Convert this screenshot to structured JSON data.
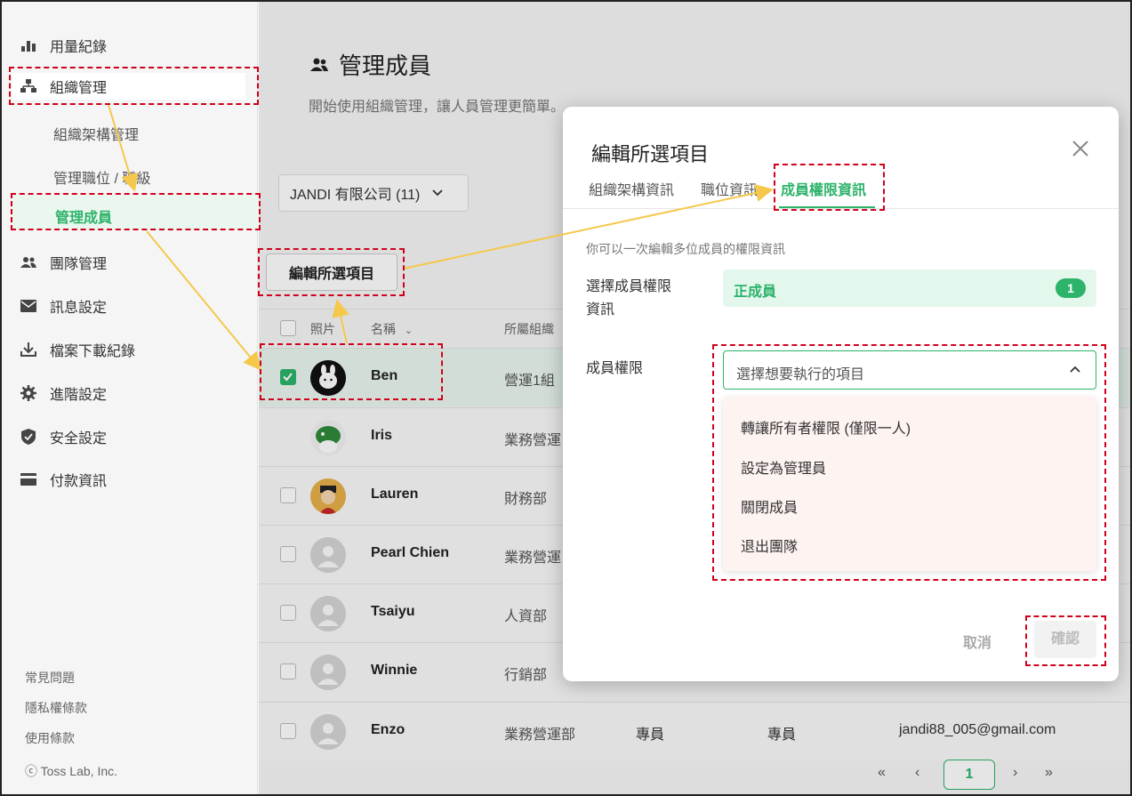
{
  "sidebar": {
    "items": [
      {
        "label": "用量紀錄",
        "icon": "bar-chart-icon"
      },
      {
        "label": "組織管理",
        "icon": "org-chart-icon"
      },
      {
        "label": "組織架構管理"
      },
      {
        "label": "管理職位 / 職級"
      },
      {
        "label": "管理成員"
      },
      {
        "label": "團隊管理",
        "icon": "team-icon"
      },
      {
        "label": "訊息設定",
        "icon": "mail-icon"
      },
      {
        "label": "檔案下載紀錄",
        "icon": "download-icon"
      },
      {
        "label": "進階設定",
        "icon": "gear-icon"
      },
      {
        "label": "安全設定",
        "icon": "shield-icon"
      },
      {
        "label": "付款資訊",
        "icon": "card-icon"
      }
    ],
    "footer": [
      "常見問題",
      "隱私權條款",
      "使用條款",
      "ⓒ Toss Lab, Inc."
    ]
  },
  "main": {
    "title": "管理成員",
    "subtitle": "開始使用組織管理，讓人員管理更簡單。",
    "company_dropdown": "JANDI 有限公司 (11)",
    "edit_button": "編輯所選項目",
    "columns": [
      "照片",
      "名稱",
      "所屬組織"
    ],
    "rows": [
      {
        "name": "Ben",
        "dept": "營運1組",
        "selected": true
      },
      {
        "name": "Iris",
        "dept": "業務營運",
        "selected": false
      },
      {
        "name": "Lauren",
        "dept": "財務部",
        "selected": false
      },
      {
        "name": "Pearl Chien",
        "dept": "業務營運",
        "selected": false
      },
      {
        "name": "Tsaiyu",
        "dept": "人資部",
        "selected": false
      },
      {
        "name": "Winnie",
        "dept": "行銷部",
        "selected": false
      },
      {
        "name": "Enzo",
        "dept": "業務營運部",
        "selected": false,
        "title": "專員",
        "rank": "專員",
        "email": "jandi88_005@gmail.com"
      }
    ],
    "pagination": {
      "first": "«",
      "prev": "‹",
      "page": "1",
      "next": "›",
      "last": "»"
    }
  },
  "modal": {
    "title": "編輯所選項目",
    "tabs": [
      "組織架構資訊",
      "職位資訊",
      "成員權限資訊"
    ],
    "active_tab": 2,
    "description": "你可以一次編輯多位成員的權限資訊",
    "role_label_line1": "選擇成員權限",
    "role_label_line2": "資訊",
    "role_value": "正成員",
    "role_count": "1",
    "permission_label": "成員權限",
    "select_placeholder": "選擇想要執行的項目",
    "options": [
      "轉讓所有者權限 (僅限一人)",
      "設定為管理員",
      "關閉成員",
      "退出團隊"
    ],
    "cancel": "取消",
    "confirm": "確認"
  },
  "colors": {
    "accent": "#2db36a",
    "annotation": "#d0021b",
    "arrow": "#f5c84c"
  }
}
